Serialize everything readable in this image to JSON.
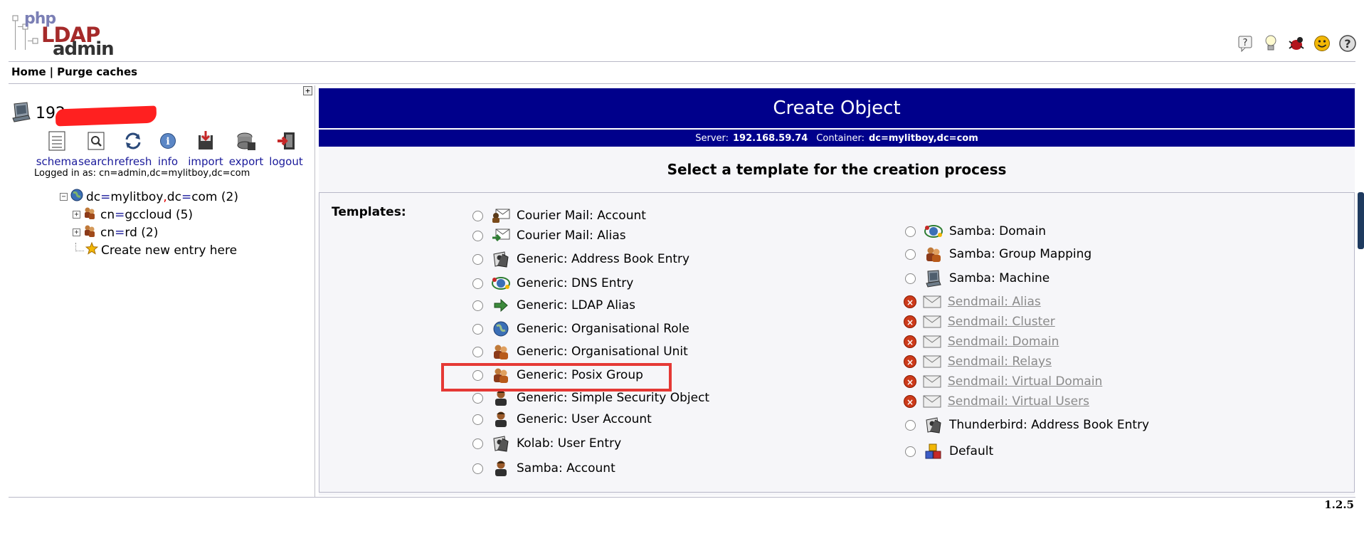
{
  "header": {
    "logo_php": "php",
    "logo_ldap": "LDAP",
    "logo_admin": "admin",
    "top_icons": [
      "help-icon",
      "bulb-icon",
      "bug-icon",
      "smiley-icon",
      "donate-icon"
    ]
  },
  "nav": {
    "home": "Home",
    "separator": "|",
    "purge": "Purge caches"
  },
  "server": {
    "name": "192"
  },
  "tools": [
    {
      "label": "schema",
      "icon": "schema-icon"
    },
    {
      "label": "search",
      "icon": "search-icon"
    },
    {
      "label": "refresh",
      "icon": "refresh-icon"
    },
    {
      "label": "info",
      "icon": "info-icon"
    },
    {
      "label": "import",
      "icon": "import-icon"
    },
    {
      "label": "export",
      "icon": "export-icon"
    },
    {
      "label": "logout",
      "icon": "logout-icon"
    }
  ],
  "logged_in": "Logged in as: cn=admin,dc=mylitboy,dc=com",
  "tree": {
    "root": {
      "k1": "dc",
      "v1": "mylitboy",
      "k2": "dc",
      "v2": "com",
      "count": "(2)"
    },
    "children": [
      {
        "k": "cn",
        "v": "gccloud",
        "count": "(5)"
      },
      {
        "k": "cn",
        "v": "rd",
        "count": "(2)"
      }
    ],
    "create_new": "Create new entry here"
  },
  "main": {
    "title": "Create Object",
    "server_label": "Server:",
    "server_value": "192.168.59.74",
    "container_label": "Container:",
    "container_value": "dc=mylitboy,dc=com",
    "select_title": "Select a template for the creation process",
    "templates_label": "Templates:"
  },
  "templates_left": [
    {
      "label": "Courier Mail: Account",
      "icon": "mail-user-icon"
    },
    {
      "label": "Courier Mail: Alias",
      "icon": "mail-alias-icon"
    },
    {
      "label": "Generic: Address Book Entry",
      "icon": "address-book-icon"
    },
    {
      "label": "Generic: DNS Entry",
      "icon": "dns-icon"
    },
    {
      "label": "Generic: LDAP Alias",
      "icon": "alias-arrow-icon"
    },
    {
      "label": "Generic: Organisational Role",
      "icon": "globe-icon"
    },
    {
      "label": "Generic: Organisational Unit",
      "icon": "group-icon"
    },
    {
      "label": "Generic: Posix Group",
      "icon": "group-icon"
    },
    {
      "label": "Generic: Simple Security Object",
      "icon": "user-icon"
    },
    {
      "label": "Generic: User Account",
      "icon": "user-icon"
    },
    {
      "label": "Kolab: User Entry",
      "icon": "address-book-icon"
    },
    {
      "label": "Samba: Account",
      "icon": "user-icon"
    }
  ],
  "templates_right": [
    {
      "label": "Samba: Domain",
      "icon": "dns-icon",
      "disabled": false
    },
    {
      "label": "Samba: Group Mapping",
      "icon": "group-icon",
      "disabled": false
    },
    {
      "label": "Samba: Machine",
      "icon": "computer-icon",
      "disabled": false
    },
    {
      "label": "Sendmail: Alias",
      "icon": "mail-icon",
      "disabled": true
    },
    {
      "label": "Sendmail: Cluster",
      "icon": "mail-icon",
      "disabled": true
    },
    {
      "label": "Sendmail: Domain",
      "icon": "mail-icon",
      "disabled": true
    },
    {
      "label": "Sendmail: Relays",
      "icon": "mail-icon",
      "disabled": true
    },
    {
      "label": "Sendmail: Virtual Domain",
      "icon": "mail-icon",
      "disabled": true
    },
    {
      "label": "Sendmail: Virtual Users",
      "icon": "mail-icon",
      "disabled": true
    },
    {
      "label": "Thunderbird: Address Book Entry",
      "icon": "address-book-icon",
      "disabled": false
    },
    {
      "label": "Default",
      "icon": "blocks-icon",
      "disabled": false
    }
  ],
  "version": "1.2.5",
  "colors": {
    "title_bar": "#00008b",
    "link": "#1a1a9a",
    "highlight": "#e53935",
    "disabled_text": "#8a8a8a"
  }
}
